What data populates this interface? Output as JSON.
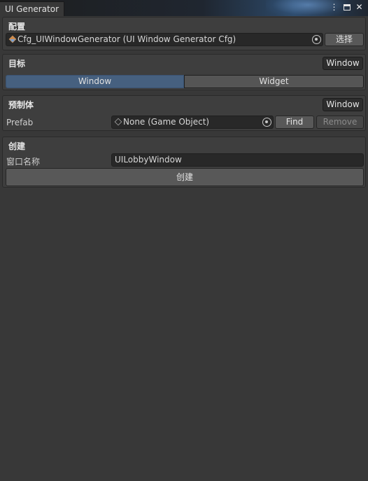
{
  "window": {
    "tab_title": "UI Generator"
  },
  "titlebar_icons": {
    "menu": "⋮",
    "maximize": "maximize-icon",
    "close": "✕"
  },
  "config": {
    "title": "配置",
    "asset_value": "Cfg_UIWindowGenerator (UI Window Generator Cfg)",
    "select_button": "选择"
  },
  "target": {
    "title": "目标",
    "mode_badge": "Window",
    "options": [
      "Window",
      "Widget"
    ],
    "selected": "Window"
  },
  "prefab": {
    "title": "预制体",
    "mode_badge": "Window",
    "label": "Prefab",
    "value": "None (Game Object)",
    "find_button": "Find",
    "remove_button": "Remove"
  },
  "create": {
    "title": "创建",
    "name_label": "窗口名称",
    "name_value": "UILobbyWindow",
    "create_button": "创建"
  },
  "colors": {
    "background": "#383838",
    "panel": "#3e3e3e",
    "accent": "#46607f"
  }
}
